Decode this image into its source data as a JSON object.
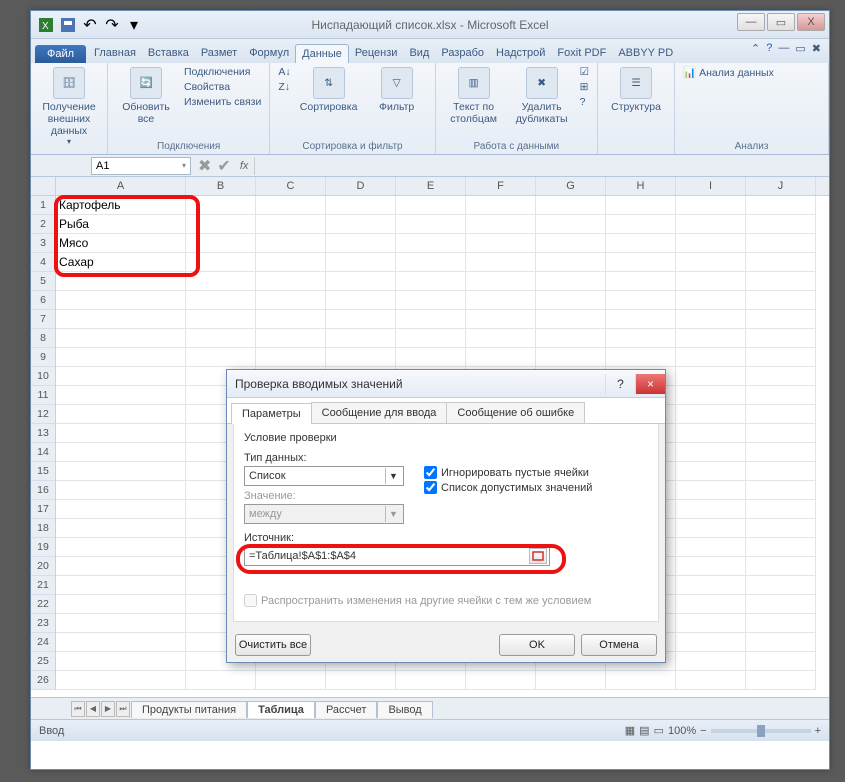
{
  "titlebar": {
    "title": "Ниспадающий список.xlsx - Microsoft Excel"
  },
  "win": {
    "min": "—",
    "max": "▭",
    "close": "X"
  },
  "tabs": {
    "file": "Файл",
    "items": [
      "Главная",
      "Вставка",
      "Размет",
      "Формул",
      "Данные",
      "Рецензи",
      "Вид",
      "Разрабо",
      "Надстрой",
      "Foxit PDF",
      "ABBYY PD"
    ],
    "active_index": 4
  },
  "ribbon": {
    "ext_data": "Получение\nвнешних данных",
    "refresh": "Обновить\nвсе",
    "connections": "Подключения",
    "conn_sub": [
      "Подключения",
      "Свойства",
      "Изменить связи"
    ],
    "sort": "Сортировка",
    "filter": "Фильтр",
    "sortfilter_group": "Сортировка и фильтр",
    "text_cols": "Текст по\nстолбцам",
    "remove_dup": "Удалить\nдубликаты",
    "data_group": "Работа с данными",
    "structure": "Структура",
    "analysis": "Анализ данных",
    "analysis_group": "Анализ"
  },
  "namebox": "A1",
  "fx": "fx",
  "columns": [
    "A",
    "B",
    "C",
    "D",
    "E",
    "F",
    "G",
    "H",
    "I",
    "J"
  ],
  "rows_count": 26,
  "cellsA": [
    "Картофель",
    "Рыба",
    "Мясо",
    "Сахар"
  ],
  "sheets": {
    "items": [
      "Продукты питания",
      "Таблица",
      "Рассчет",
      "Вывод"
    ],
    "active_index": 1
  },
  "status": {
    "mode": "Ввод",
    "zoom": "100%",
    "minus": "−",
    "plus": "+"
  },
  "dialog": {
    "title": "Проверка вводимых значений",
    "help": "?",
    "close": "×",
    "tabs": [
      "Параметры",
      "Сообщение для ввода",
      "Сообщение об ошибке"
    ],
    "active_tab": 0,
    "cond_heading": "Условие проверки",
    "type_label": "Тип данных:",
    "type_value": "Список",
    "ignore_blank": "Игнорировать пустые ячейки",
    "in_cell_list": "Список допустимых значений",
    "value_label": "Значение:",
    "value_value": "между",
    "source_label": "Источник:",
    "source_value": "=Таблица!$A$1:$A$4",
    "propagate": "Распространить изменения на другие ячейки с тем же условием",
    "clear": "Очистить все",
    "ok": "OK",
    "cancel": "Отмена"
  }
}
